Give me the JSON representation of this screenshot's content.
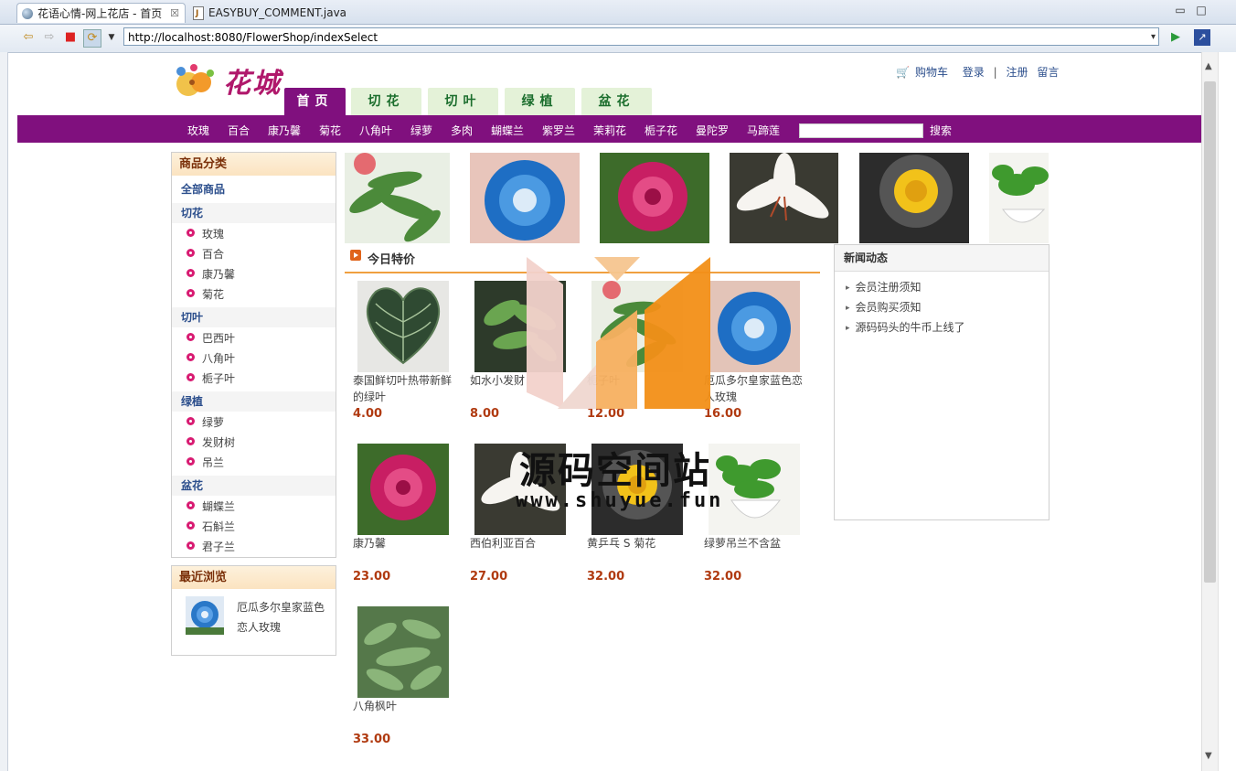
{
  "browser": {
    "tabs": [
      {
        "label": "花语心情-网上花店 - 首页",
        "close": "☒",
        "icon": "globe-icon"
      },
      {
        "label": "EASYBUY_COMMENT.java",
        "icon": "java-file-icon"
      }
    ],
    "url": "http://localhost:8080/FlowerShop/indexSelect"
  },
  "header": {
    "logo_text": "花城",
    "links": {
      "cart": "购物车",
      "login": "登录",
      "sep": "|",
      "register": "注册",
      "message": "留言"
    },
    "main_tabs": [
      "首页",
      "切花",
      "切叶",
      "绿植",
      "盆花"
    ]
  },
  "category_bar": {
    "links": [
      "玫瑰",
      "百合",
      "康乃馨",
      "菊花",
      "八角叶",
      "绿萝",
      "多肉",
      "蝴蝶兰",
      "紫罗兰",
      "茉莉花",
      "栀子花",
      "曼陀罗",
      "马蹄莲"
    ],
    "search_label": "搜索"
  },
  "sidebar": {
    "title": "商品分类",
    "all": "全部商品",
    "groups": [
      {
        "name": "切花",
        "items": [
          "玫瑰",
          "百合",
          "康乃馨",
          "菊花"
        ]
      },
      {
        "name": "切叶",
        "items": [
          "巴西叶",
          "八角叶",
          "栀子叶"
        ]
      },
      {
        "name": "绿植",
        "items": [
          "绿萝",
          "发财树",
          "吊兰"
        ]
      },
      {
        "name": "盆花",
        "items": [
          "蝴蝶兰",
          "石斛兰",
          "君子兰"
        ]
      }
    ],
    "recent_title": "最近浏览",
    "recent_item": "厄瓜多尔皇家蓝色恋人玫瑰"
  },
  "specials": {
    "title": "今日特价",
    "products": [
      {
        "name": "泰国鲜切叶热带新鲜的绿叶",
        "price": "4.00"
      },
      {
        "name": "如水小发财",
        "price": "8.00"
      },
      {
        "name": "栀子叶",
        "price": "12.00"
      },
      {
        "name": "厄瓜多尔皇家蓝色恋人玫瑰",
        "price": "16.00"
      },
      {
        "name": "康乃馨",
        "price": "23.00"
      },
      {
        "name": "西伯利亚百合",
        "price": "27.00"
      },
      {
        "name": "黄乒乓 S 菊花",
        "price": "32.00"
      },
      {
        "name": "绿萝吊兰不含盆",
        "price": "32.00"
      },
      {
        "name": "八角枫叶",
        "price": "33.00"
      }
    ]
  },
  "news": {
    "title": "新闻动态",
    "items": [
      "会员注册须知",
      "会员购买须知",
      "源码码头的牛币上线了"
    ]
  },
  "watermark": {
    "cn": "源码空间站",
    "url": "www.shuyue.fun"
  },
  "colors": {
    "brand_purple": "#80107e",
    "tab_green": "#e4f2d8",
    "price_red": "#b03a10",
    "link_blue": "#2b4e8c"
  }
}
